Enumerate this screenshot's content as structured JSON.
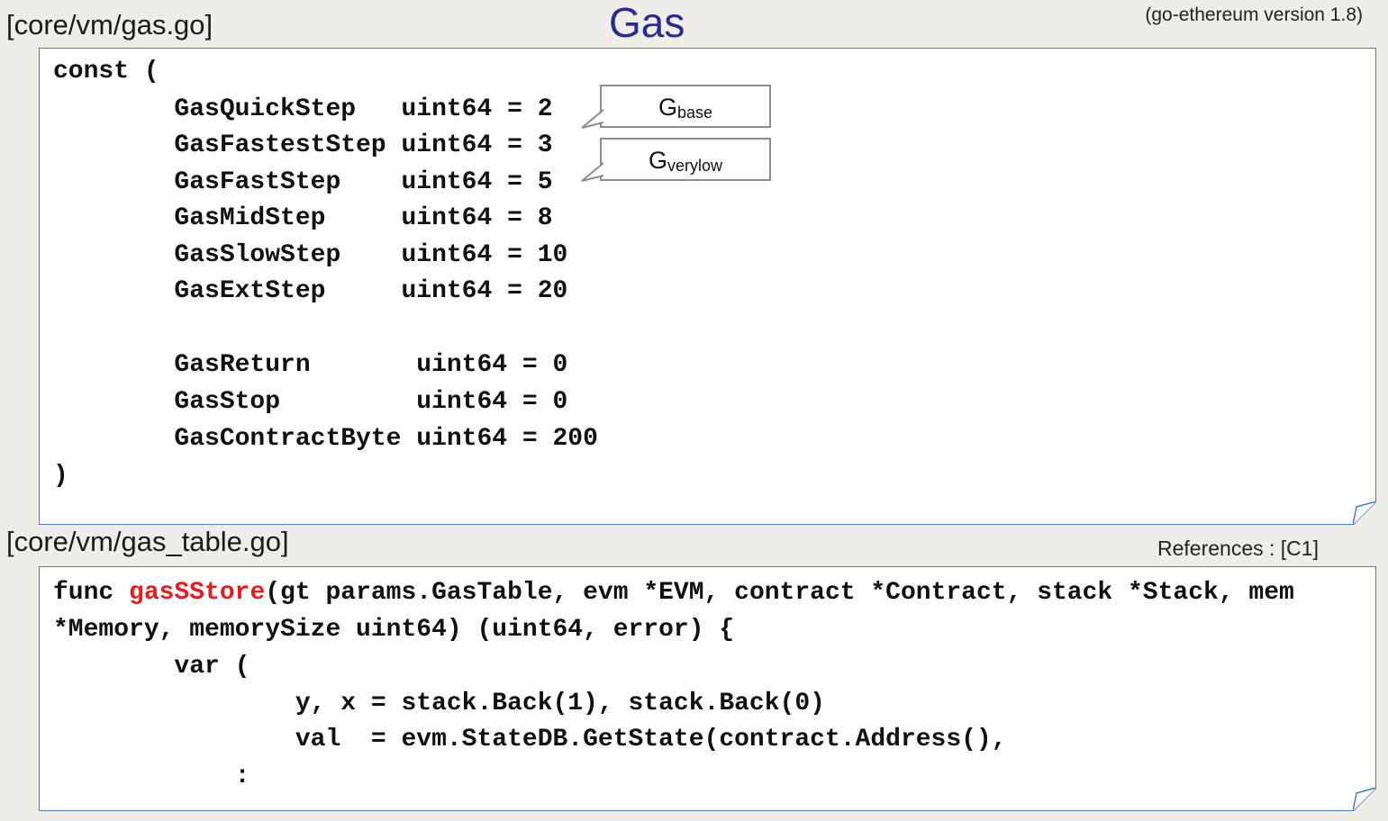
{
  "header": {
    "file_top": "[core/vm/gas.go]",
    "title": "Gas",
    "version": "(go-ethereum version 1.8)"
  },
  "block1": {
    "lines": [
      "const (",
      "        GasQuickStep   uint64 = 2",
      "        GasFastestStep uint64 = 3",
      "        GasFastStep    uint64 = 5",
      "        GasMidStep     uint64 = 8",
      "        GasSlowStep    uint64 = 10",
      "        GasExtStep     uint64 = 20",
      "        GasReturn       uint64 = 0",
      "        GasStop         uint64 = 0",
      "        GasContractByte uint64 = 200",
      ")"
    ]
  },
  "callouts": {
    "base": {
      "main": "G",
      "sub": "base"
    },
    "verylow": {
      "main": "G",
      "sub": "verylow"
    }
  },
  "section2": {
    "file": "[core/vm/gas_table.go]",
    "references": "References : [C1]"
  },
  "block2": {
    "line1_prefix": "func ",
    "line1_highlight": "gasSStore",
    "line1_suffix": "(gt params.GasTable, evm *EVM, contract *Contract, stack *Stack, mem",
    "lines": [
      "*Memory, memorySize uint64) (uint64, error) {",
      "        var (",
      "                y, x = stack.Back(1), stack.Back(0)",
      "                val  = evm.StateDB.GetState(contract.Address(),",
      "            :"
    ]
  },
  "colors": {
    "background": "#efede7",
    "title": "#2b2b8f",
    "box_border": "#4a7cc0",
    "highlight": "#e02020",
    "callout_border": "#8c8c8c"
  }
}
